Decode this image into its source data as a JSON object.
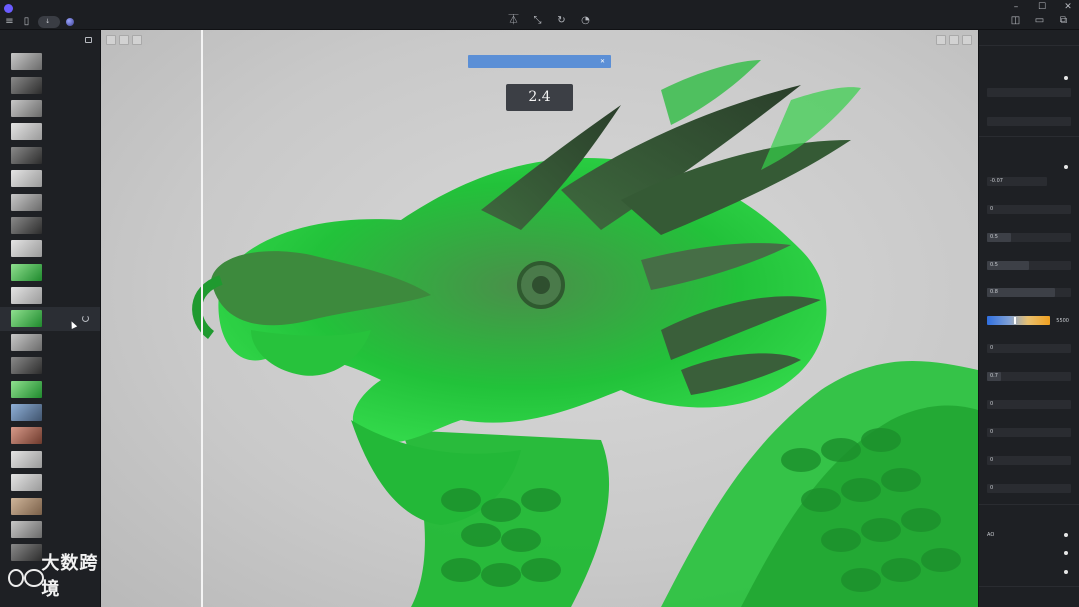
{
  "app": {
    "title": ""
  },
  "toolbar": {
    "import_label": ""
  },
  "sidebar": {
    "title": "",
    "items": [
      {
        "label": "",
        "thumb": "t-gray"
      },
      {
        "label": "",
        "thumb": "t-dark"
      },
      {
        "label": "",
        "thumb": "t-gray"
      },
      {
        "label": "",
        "thumb": "t-light"
      },
      {
        "label": "",
        "thumb": "t-dark"
      },
      {
        "label": "",
        "thumb": "t-light"
      },
      {
        "label": "",
        "thumb": "t-gray"
      },
      {
        "label": "",
        "thumb": "t-dark"
      },
      {
        "label": "",
        "thumb": "t-light"
      },
      {
        "label": "",
        "thumb": "t-green"
      },
      {
        "label": "",
        "thumb": "t-light"
      },
      {
        "label": "",
        "thumb": "t-green",
        "selected": true
      },
      {
        "label": "",
        "thumb": "t-gray"
      },
      {
        "label": "",
        "thumb": "t-dark"
      },
      {
        "label": "",
        "thumb": "t-green"
      },
      {
        "label": "",
        "thumb": "t-blue"
      },
      {
        "label": "",
        "thumb": "t-red"
      },
      {
        "label": "",
        "thumb": "t-light"
      },
      {
        "label": "",
        "thumb": "t-light"
      },
      {
        "label": "",
        "thumb": "t-wood"
      },
      {
        "label": "",
        "thumb": "t-gray"
      },
      {
        "label": "",
        "thumb": "t-dark"
      }
    ]
  },
  "watermark": {
    "text": "大数跨境"
  },
  "viewport": {
    "notice_text": "",
    "value_tip": "2.4",
    "left_tools": [
      "",
      "",
      ""
    ],
    "right_tools": [
      "",
      "",
      ""
    ]
  },
  "rpanel": {
    "tabs": [
      "",
      ""
    ],
    "fields": {
      "v1": "-0.07",
      "v2": "0",
      "v3": "0.5",
      "v4": "0.5",
      "v5": "0.8",
      "v6": "0",
      "v7": "0.7",
      "v8": "0",
      "v9": "0",
      "v10": "0",
      "v11": "0",
      "grad_value": "5500"
    },
    "section_labels": {
      "s2_label_1": "AO"
    }
  },
  "colors": {
    "accent": "#5b8fd6",
    "jade": "#22c23a",
    "panel": "#1e2024"
  }
}
